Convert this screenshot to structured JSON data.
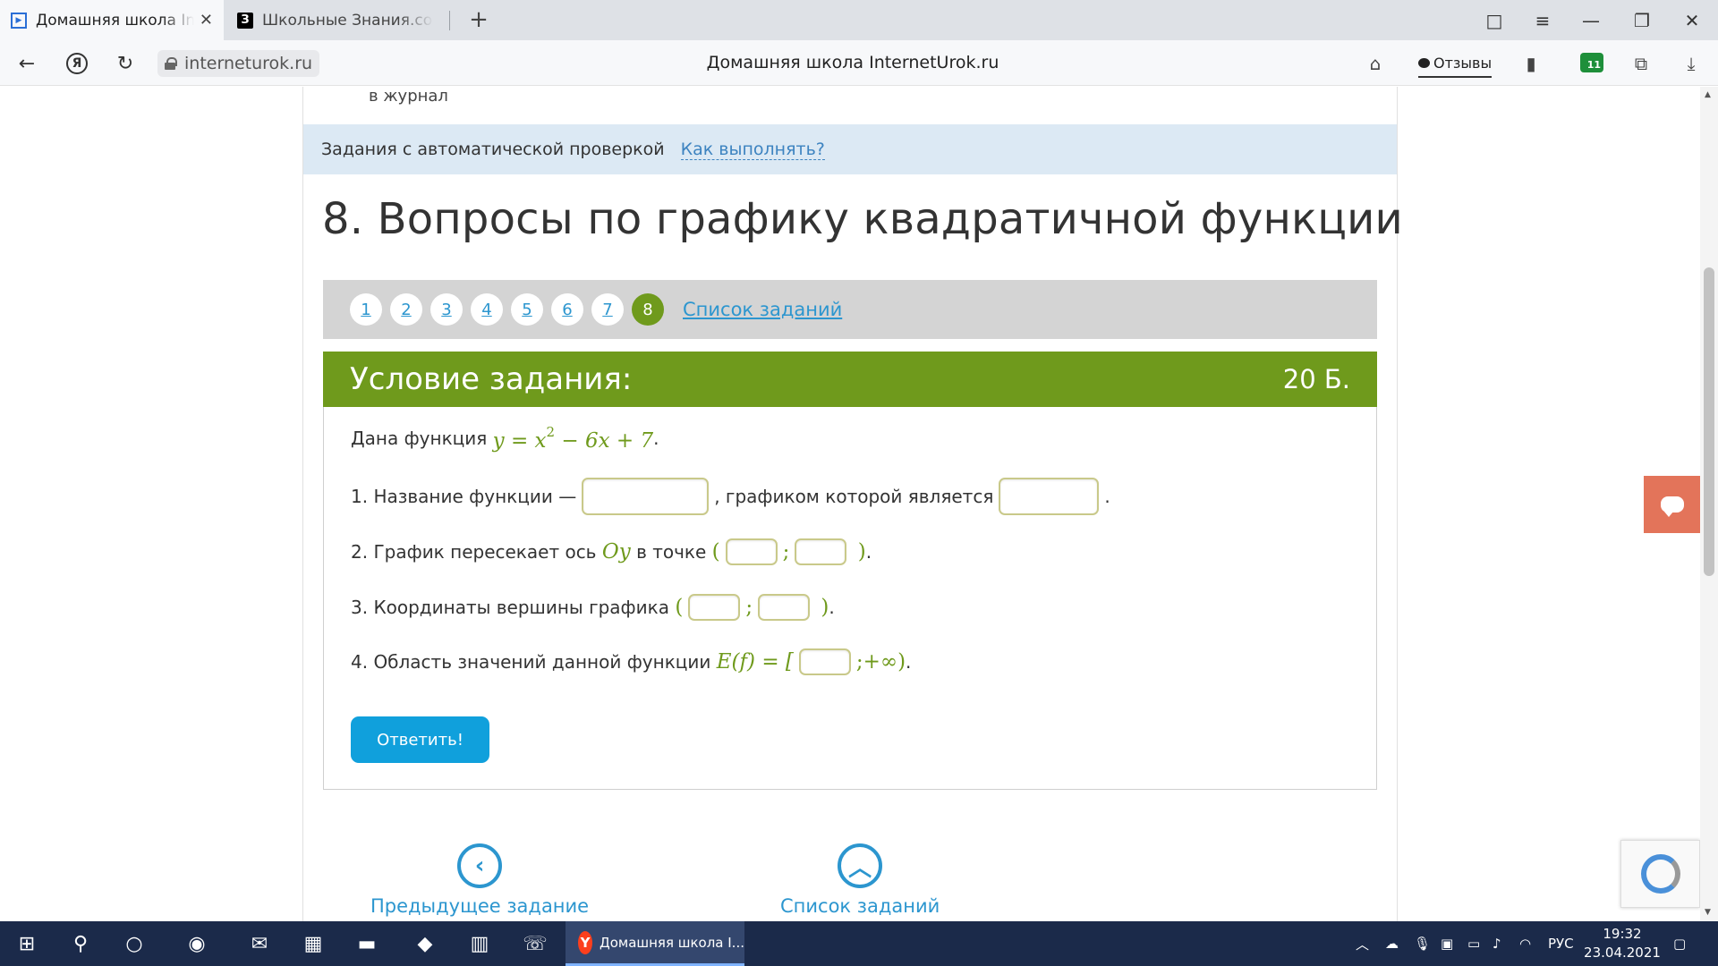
{
  "browser": {
    "tabs": [
      {
        "title": "Домашняя школа InternetUrok.ru",
        "active": true
      },
      {
        "title": "Школьные Знания.com - Решаем вместе",
        "active": false
      }
    ],
    "new_tab": "+",
    "window_controls": [
      "□",
      "≡",
      "—",
      "❐",
      "✕"
    ],
    "url": "interneturok.ru",
    "page_title": "Домашняя школа InternetUrok.ru",
    "reviews_label": "Отзывы",
    "downloads_badge": "11"
  },
  "page": {
    "journal_text": "в журнал",
    "auto_check_label": "Задания с автоматической проверкой",
    "how_to_link": "Как выполнять?",
    "heading": "8. Вопросы по графику квадратичной функции",
    "pager": {
      "pages": [
        "1",
        "2",
        "3",
        "4",
        "5",
        "6",
        "7",
        "8"
      ],
      "current": "8",
      "list_link": "Список заданий"
    },
    "task": {
      "title": "Условие задания:",
      "points": "20 Б.",
      "intro_text": "Дана функция",
      "function": {
        "lhs": "y = x",
        "exp": "2",
        "rhs": " − 6x + 7"
      },
      "intro_end": ".",
      "q1_prefix": "1. Название функции —",
      "q1_middle": ", графиком которой является",
      "q1_end": ".",
      "q2_prefix": "2. График пересекает ось",
      "q2_axis": "Oy",
      "q2_middle": "в точке",
      "q3_prefix": "3. Координаты вершины графика",
      "q4_prefix": "4. Область значений данной функции",
      "q4_math": "E(f) = [",
      "q4_tail": ";+∞)",
      "open_paren": "(",
      "close_paren": ")",
      "semicolon": ";",
      "period": ".",
      "answer_button": "Ответить!"
    },
    "bottom_nav": {
      "prev_label": "Предыдущее задание",
      "list_label": "Список заданий"
    }
  },
  "taskbar": {
    "active_app": "Домашняя школа I...",
    "language": "РУС",
    "time": "19:32",
    "date": "23.04.2021"
  }
}
